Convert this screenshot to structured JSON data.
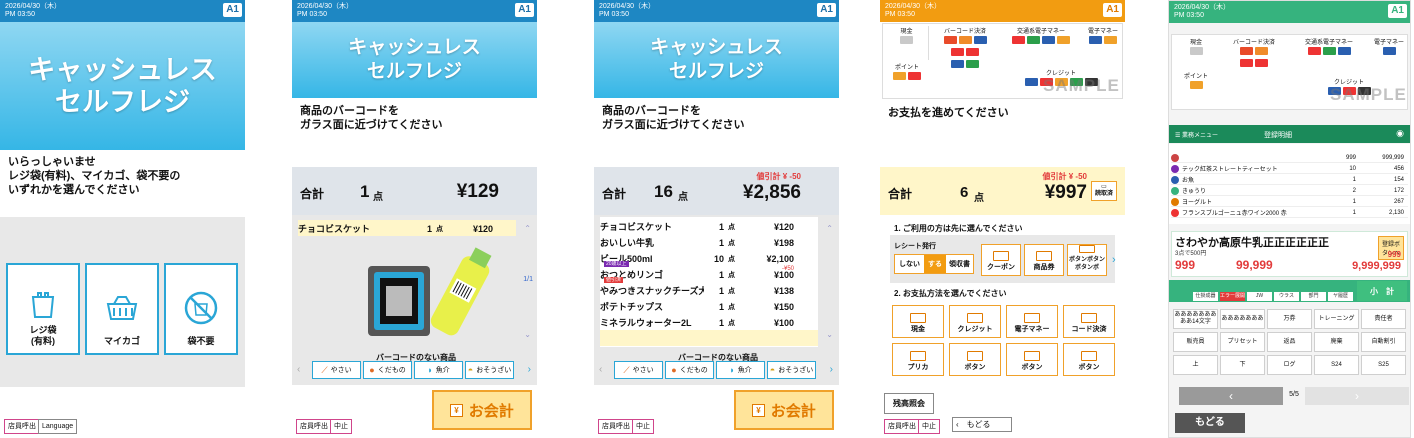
{
  "common": {
    "datetime_line1": "2026/04/30（木）",
    "datetime_line2": "PM 03:50",
    "terminal": "A1"
  },
  "title": {
    "line1": "キャッシュレス",
    "line2": "セルフレジ"
  },
  "p1": {
    "greeting_l1": "いらっしゃいませ",
    "greeting_l2": "レジ袋(有料)、マイカゴ、袋不要の",
    "greeting_l3": "いずれかを選んでください",
    "opt_bag_l1": "レジ袋",
    "opt_bag_l2": "(有料)",
    "opt_mybasket": "マイカゴ",
    "opt_nobag": "袋不要",
    "staff_call": "店員呼出",
    "language": "Language"
  },
  "p2": {
    "msg_l1": "商品のバーコードを",
    "msg_l2": "ガラス面に近づけてください",
    "total_label": "合計",
    "count": "1",
    "count_unit": "点",
    "total": "¥129",
    "item_name": "チョコビスケット",
    "item_qty": "1",
    "item_unit": "点",
    "item_price": "¥120",
    "page": "1/1",
    "no_barcode": "バーコードのない商品",
    "staff_call": "店員呼出",
    "cancel": "中止",
    "checkout": "お会計"
  },
  "cats": [
    "やさい",
    "くだもの",
    "魚介",
    "おそうざい"
  ],
  "p3": {
    "msg_l1": "商品のバーコードを",
    "msg_l2": "ガラス面に近づけてください",
    "total_label": "合計",
    "count": "16",
    "count_unit": "点",
    "total": "¥2,856",
    "discount": "値引計 ¥ -50",
    "items": [
      {
        "name": "チョコビスケット",
        "qty": "1",
        "unit": "点",
        "price": "¥120",
        "note": ""
      },
      {
        "name": "おいしい牛乳",
        "qty": "1",
        "unit": "点",
        "price": "¥198",
        "note": ""
      },
      {
        "name": "ビール500ml",
        "qty": "10",
        "unit": "点",
        "price": "¥2,100",
        "note": "20歳以上"
      },
      {
        "name": "おつとめリンゴ",
        "qty": "1",
        "unit": "点",
        "price": "¥100",
        "note": "値引済",
        "disc": "-¥50"
      },
      {
        "name": "やみつきスナックチーズ大",
        "qty": "1",
        "unit": "点",
        "price": "¥138",
        "note": ""
      },
      {
        "name": "ポテトチップス",
        "qty": "1",
        "unit": "点",
        "price": "¥150",
        "note": ""
      },
      {
        "name": "ミネラルウォーター2L",
        "qty": "1",
        "unit": "点",
        "price": "¥100",
        "note": ""
      }
    ],
    "no_barcode": "バーコードのない商品",
    "staff_call": "店員呼出",
    "cancel": "中止",
    "checkout": "お会計"
  },
  "logos": {
    "cash": "現金",
    "barcode": "バーコード決済",
    "transit": "交通系電子マネー",
    "emoney": "電子マネー",
    "point": "ポイント",
    "credit": "クレジット",
    "sample": "SAMPLE"
  },
  "p4": {
    "msg": "お支払を進めてください",
    "total_label": "合計",
    "count": "6",
    "count_unit": "点",
    "total": "¥997",
    "discount": "値引計 ¥ -50",
    "stamp": "読取済",
    "step1": "1. ご利用の方は先に選んでください",
    "receipt": "レシート発行",
    "no": "しない",
    "yes": "する",
    "ryoshu": "領収書",
    "coupon": "クーポン",
    "voucher": "商品券",
    "button_btn": "ボタンボタンボタンボ",
    "step2": "2. お支払方法を選んでください",
    "methods": [
      "現金",
      "クレジット",
      "電子マネー",
      "コード決済",
      "プリカ",
      "ボタン",
      "ボタン",
      "ボタン"
    ],
    "balance": "残高照会",
    "staff_call": "店員呼出",
    "cancel": "中止",
    "back": "もどる"
  },
  "p5": {
    "menu": "業務メニュー",
    "screen_title": "登録明細",
    "rows": [
      {
        "name": "",
        "qty": "999",
        "price": "999,999"
      },
      {
        "name": "テック紅茶ストレートティーセット",
        "qty": "10",
        "price": "456"
      },
      {
        "name": "お魚",
        "qty": "1",
        "price": "154"
      },
      {
        "name": "きゅうり",
        "qty": "2",
        "price": "172"
      },
      {
        "name": "ヨーグルト",
        "qty": "1",
        "price": "267"
      },
      {
        "name": "フランスブルゴーニュ赤ワイン2000 赤",
        "qty": "1",
        "price": "2,130"
      }
    ],
    "promo": "さわやか高原牛乳正正正正正正",
    "promo_sub": "3点で500円",
    "promo_btn": "登録ボタンへ",
    "sum_a": "999",
    "sum_b": "99,999",
    "sum_c": "9,999,999",
    "sum_d": "999",
    "keytabs": [
      "仕掛成器",
      "エラー展開",
      "JW",
      "ウラス",
      "部門",
      "ヤ履歴"
    ],
    "subtotal": "小　計",
    "keys": [
      "あああああああああ14文字",
      "あああああああ",
      "万券",
      "トレーニング",
      "責任者",
      "販売員",
      "プリセット",
      "返品",
      "廃棄",
      "自動割引",
      "上",
      "下",
      "ログ",
      "S24",
      "S25"
    ],
    "page": "5/5",
    "back": "もどる"
  }
}
